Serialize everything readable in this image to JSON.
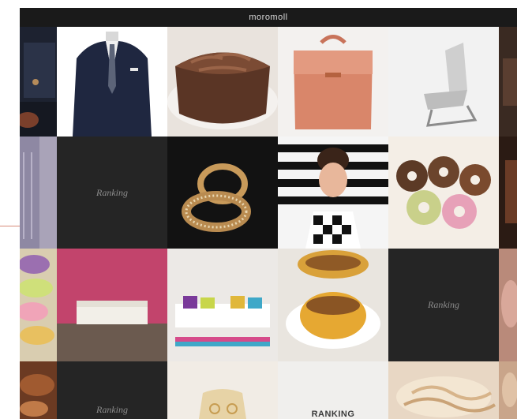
{
  "app": {
    "brand": "moromoll"
  },
  "grid": {
    "tiles": [
      {
        "id": "jeans",
        "kind": "photo"
      },
      {
        "id": "suit",
        "kind": "photo"
      },
      {
        "id": "cake",
        "kind": "photo"
      },
      {
        "id": "handbag",
        "kind": "photo"
      },
      {
        "id": "chair",
        "kind": "photo"
      },
      {
        "id": "dark-edge",
        "kind": "photo"
      },
      {
        "id": "knit",
        "kind": "photo"
      },
      {
        "id": "ranking-1",
        "kind": "ranking",
        "label": "Ranking"
      },
      {
        "id": "rings",
        "kind": "photo"
      },
      {
        "id": "model-stripes",
        "kind": "photo"
      },
      {
        "id": "donuts",
        "kind": "photo"
      },
      {
        "id": "edge-2",
        "kind": "photo"
      },
      {
        "id": "macarons",
        "kind": "photo"
      },
      {
        "id": "sofa-pink",
        "kind": "photo"
      },
      {
        "id": "sofa-white",
        "kind": "photo"
      },
      {
        "id": "pudding",
        "kind": "photo"
      },
      {
        "id": "ranking-2",
        "kind": "ranking",
        "label": "Ranking"
      },
      {
        "id": "edge-3",
        "kind": "photo"
      },
      {
        "id": "food",
        "kind": "photo"
      },
      {
        "id": "ranking-3",
        "kind": "ranking",
        "label": "Ranking"
      },
      {
        "id": "gold",
        "kind": "photo"
      },
      {
        "id": "ranking-4",
        "kind": "ranking",
        "label": "RANKING"
      },
      {
        "id": "noodles",
        "kind": "photo"
      },
      {
        "id": "edge-4",
        "kind": "photo"
      }
    ]
  }
}
